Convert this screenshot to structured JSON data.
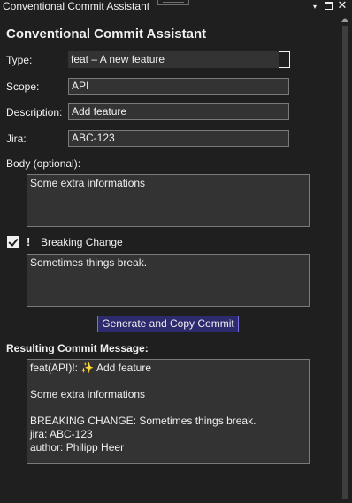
{
  "window": {
    "title": "Conventional Commit Assistant",
    "dropdown_glyph": "▾",
    "close_glyph": "✕"
  },
  "heading": "Conventional Commit Assistant",
  "form": {
    "type_label": "Type:",
    "type_value": "feat – A new feature",
    "scope_label": "Scope:",
    "scope_value": "API",
    "description_label": "Description:",
    "description_value": "Add feature",
    "jira_label": "Jira:",
    "jira_value": "ABC-123",
    "body_label": "Body (optional):",
    "body_value": "Some extra informations",
    "breaking_checked": true,
    "breaking_icon": "!",
    "breaking_label": "Breaking Change",
    "breaking_value": "Sometimes things break."
  },
  "actions": {
    "generate_label": "Generate and Copy Commit"
  },
  "result": {
    "label": "Resulting Commit Message:",
    "line1_prefix": "feat(API)!: ",
    "line1_icon": "✨",
    "line1_suffix": " Add feature",
    "line2": "Some extra informations",
    "line3": "BREAKING CHANGE: Sometimes things break.",
    "line4": "jira: ABC-123",
    "line5": "author: Philipp Heer"
  },
  "icons": {
    "dropdown": "window-dropdown-icon",
    "maximize": "maximize-icon",
    "close": "close-icon",
    "checkbox": "checkmark-icon",
    "breaking": "exclamation-icon",
    "sparkles": "sparkles-icon"
  }
}
